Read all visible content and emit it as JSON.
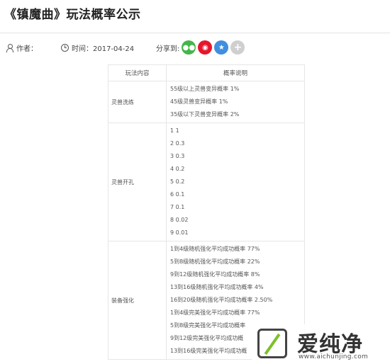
{
  "article": {
    "title": "《镇魔曲》玩法概率公示",
    "author_label": "作者：",
    "time_label": "时间：2017-04-24",
    "share_label": "分享到:",
    "share_buttons": [
      {
        "name": "wechat",
        "icon": "wechat-icon",
        "glyph": "●●",
        "color": "#44b549"
      },
      {
        "name": "weibo",
        "icon": "weibo-icon",
        "glyph": "◉",
        "color": "#e6162d"
      },
      {
        "name": "qzone",
        "icon": "qzone-icon",
        "glyph": "★",
        "color": "#3f8ee0"
      },
      {
        "name": "more",
        "icon": "plus-icon",
        "glyph": "+",
        "color": "#cfcfcf"
      }
    ]
  },
  "table": {
    "headers": [
      "玩法内容",
      "概率说明"
    ],
    "rows": [
      {
        "category": "灵兽洗练",
        "lines": [
          "55级以上灵兽变异概率 1%",
          "45级灵兽变异概率 1%",
          "35级以下灵兽变异概率 2%"
        ]
      },
      {
        "category": "灵兽开孔",
        "lines": [
          "1 1",
          "2 0.3",
          "3 0.3",
          "4 0.2",
          "5 0.2",
          "6 0.1",
          "7 0.1",
          "8 0.02",
          "9 0.01"
        ]
      },
      {
        "category": "装备强化",
        "lines": [
          "1到4级随机强化平均成功概率 77%",
          "5到8级随机强化平均成功概率 22%",
          "9到12级随机强化平均成功概率 8%",
          "13到16级随机强化平均成功概率 4%",
          "16到20级随机强化平均成功概率 2.50%",
          "1到4级完美强化平均成功概率 77%",
          "5到8级完美强化平均成功概率",
          "9到12级完美强化平均成功概",
          "13到16级完美强化平均成功概"
        ]
      }
    ]
  },
  "watermark": {
    "logo_text": "爱纯净",
    "url": "www.aichunjing.com"
  }
}
